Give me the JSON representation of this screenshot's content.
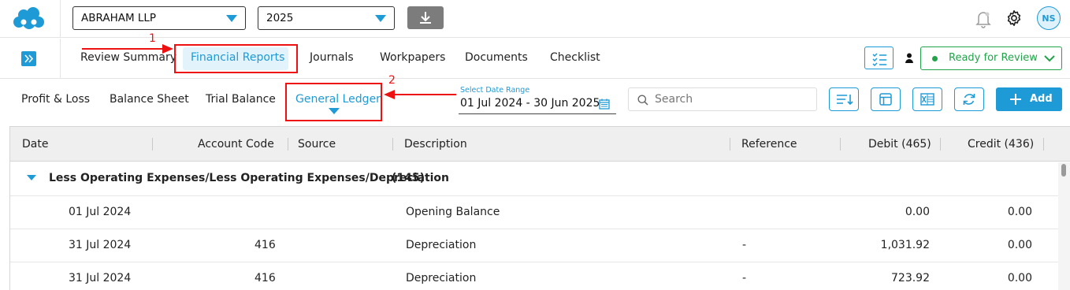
{
  "topbar": {
    "client": "ABRAHAM LLP",
    "year": "2025",
    "avatar_initials": "NS",
    "icons": [
      "cloud-logo-icon",
      "download-icon",
      "bell-icon",
      "gear-icon"
    ]
  },
  "nav": {
    "tabs": [
      {
        "label": "Review Summary"
      },
      {
        "label": "Financial Reports",
        "active": true
      },
      {
        "label": "Journals"
      },
      {
        "label": "Workpapers"
      },
      {
        "label": "Documents"
      },
      {
        "label": "Checklist"
      }
    ],
    "status": "Ready for Review"
  },
  "annotations": {
    "marker1": "1",
    "marker2": "2",
    "color": "#e11111"
  },
  "subnav": {
    "reports": [
      {
        "label": "Profit & Loss"
      },
      {
        "label": "Balance Sheet"
      },
      {
        "label": "Trial Balance"
      },
      {
        "label": "General Ledger",
        "active": true
      }
    ],
    "date_range_label": "Select Date Range",
    "date_range_value": "01 Jul 2024 - 30 Jun 2025",
    "search_placeholder": "Search",
    "add_label": "Add"
  },
  "grid": {
    "columns": [
      "Date",
      "Account Code",
      "Source",
      "Description",
      "Reference",
      "Debit (465)",
      "Credit (436)"
    ],
    "group": {
      "title": "Less Operating Expenses/Less Operating Expenses/Depreciation",
      "count": "(145)"
    },
    "rows": [
      {
        "date": "01 Jul 2024",
        "source": "",
        "description": "Opening Balance",
        "reference": "",
        "debit": "0.00",
        "credit": "0.00"
      },
      {
        "date": "31 Jul 2024",
        "source": "416",
        "description": "Depreciation",
        "reference": "-",
        "debit": "1,031.92",
        "credit": "0.00"
      },
      {
        "date": "31 Jul 2024",
        "source": "416",
        "description": "Depreciation",
        "reference": "-",
        "debit": "723.92",
        "credit": "0.00"
      }
    ]
  },
  "colors": {
    "accent": "#1e9ad6",
    "status_green": "#22a34a",
    "annotation_red": "#e11111"
  }
}
